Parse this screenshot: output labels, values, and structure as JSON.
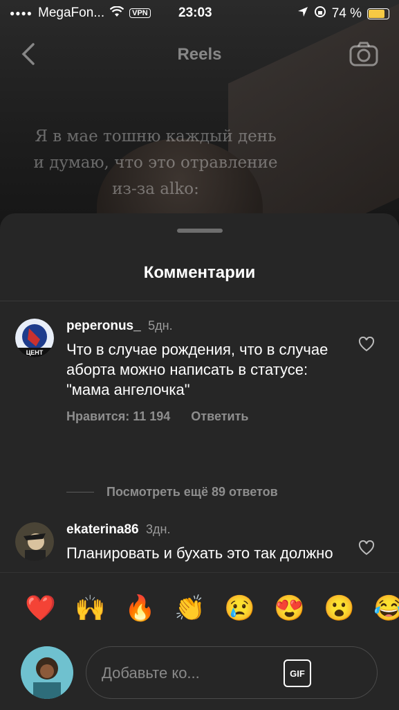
{
  "status_bar": {
    "carrier": "MegaFon...",
    "vpn": "VPN",
    "time": "23:03",
    "battery": "74 %"
  },
  "header": {
    "title": "Reels"
  },
  "background": {
    "caption": "Я в мае тошню каждый день и думаю, что это отравление из-за alko:"
  },
  "sheet": {
    "title": "Комментарии"
  },
  "comments": [
    {
      "username": "peperonus_",
      "time": "5дн.",
      "text": "Что в случае рождения, что в случае аборта можно написать в статусе: \"мама ангелочка\"",
      "likes": "Нравится: 11 194",
      "reply": "Ответить"
    },
    {
      "username": "ekaterina86",
      "time": "3дн.",
      "text": "Планировать и бухать это так должно"
    }
  ],
  "more_replies": "Посмотреть ещё 89 ответов",
  "emoji_bar": [
    "❤️",
    "🙌",
    "🔥",
    "👏",
    "😢",
    "😍",
    "😮",
    "😂"
  ],
  "composer": {
    "placeholder": "Добавьте ко...",
    "gif_label": "GIF"
  }
}
